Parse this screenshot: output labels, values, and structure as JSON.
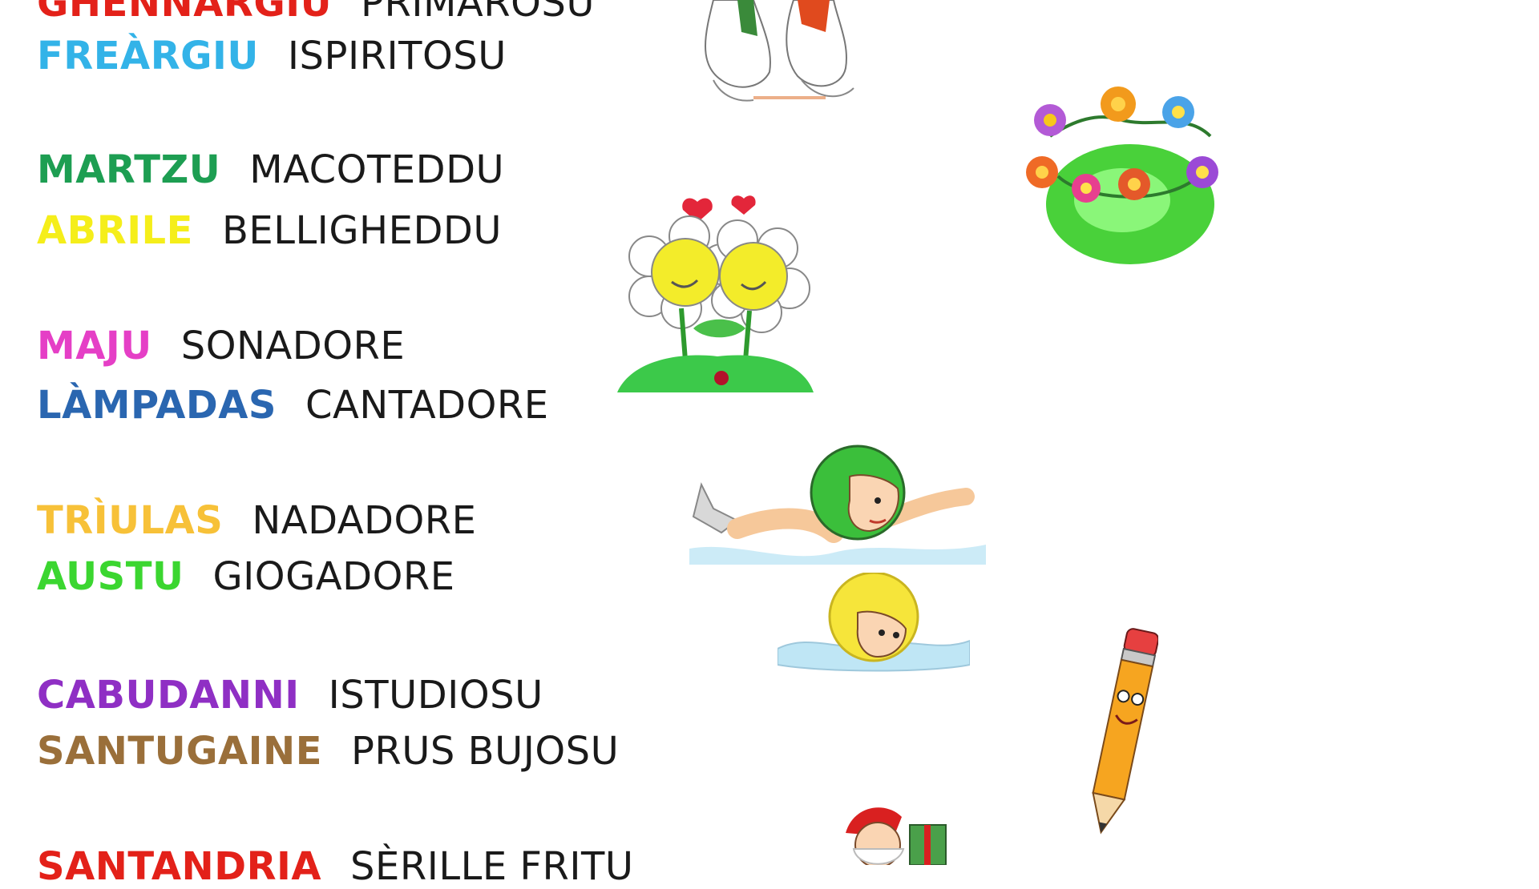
{
  "months": [
    {
      "month": "GHENNÀRGIU",
      "word": "PRIMAROSU",
      "color": "#e32119"
    },
    {
      "month": "FREÀRGIU",
      "word": "ISPIRITOSU",
      "color": "#33b3e8"
    },
    {
      "month": "MARTZU",
      "word": "MACOTEDDU",
      "color": "#1d9e52"
    },
    {
      "month": "ABRILE",
      "word": "BELLIGHEDDU",
      "color": "#f5ee1a"
    },
    {
      "month": "MAJU",
      "word": "SONADORE",
      "color": "#e53fc6"
    },
    {
      "month": "LÀMPADAS",
      "word": "CANTADORE",
      "color": "#2a66b0"
    },
    {
      "month": "TRÌULAS",
      "word": "NADADORE",
      "color": "#f7c138"
    },
    {
      "month": "AUSTU",
      "word": "GIOGADORE",
      "color": "#3bd630"
    },
    {
      "month": "CABUDANNI",
      "word": "ISTUDIOSU",
      "color": "#8f2fc4"
    },
    {
      "month": "SANTUGAINE",
      "word": "PRUS BUJOSU",
      "color": "#9a6f3a"
    },
    {
      "month": "SANTANDRIA",
      "word": "SÈRILLE FRITU",
      "color": "#e32119"
    }
  ],
  "illustrations": [
    {
      "name": "birds",
      "icon": "two-birds-icon"
    },
    {
      "name": "flower-wreath",
      "icon": "flower-wreath-icon"
    },
    {
      "name": "flower-couple",
      "icon": "flower-couple-icon"
    },
    {
      "name": "swimmer-boy",
      "icon": "swimmer-icon"
    },
    {
      "name": "swimmer-girl",
      "icon": "swimmer-girl-icon"
    },
    {
      "name": "pencil",
      "icon": "pencil-icon"
    },
    {
      "name": "santa",
      "icon": "santa-icon"
    }
  ]
}
